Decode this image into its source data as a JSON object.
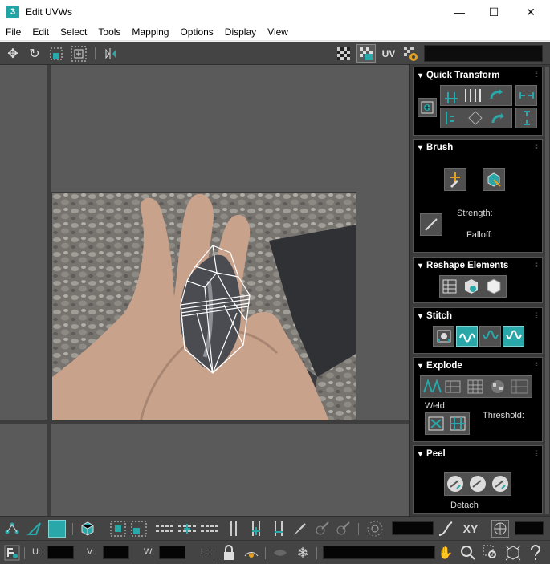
{
  "window": {
    "title": "Edit UVWs",
    "app_icon_text": "3",
    "minimize": "—",
    "maximize": "☐",
    "close": "✕"
  },
  "menu": [
    "File",
    "Edit",
    "Select",
    "Tools",
    "Mapping",
    "Options",
    "Display",
    "View"
  ],
  "toolbar": {
    "uv_label": "UV"
  },
  "panels": {
    "quick_transform": "Quick Transform",
    "brush": "Brush",
    "brush_strength": "Strength:",
    "brush_falloff": "Falloff:",
    "reshape": "Reshape Elements",
    "stitch": "Stitch",
    "explode": "Explode",
    "weld": "Weld",
    "threshold": "Threshold:",
    "peel": "Peel",
    "detach": "Detach"
  },
  "bottom": {
    "xy_label": "XY",
    "u_label": "U:",
    "v_label": "V:",
    "w_label": "W:",
    "l_label": "L:"
  },
  "colors": {
    "accent": "#2aa7a8",
    "panel_bg": "#000000",
    "toolbar_bg": "#444444",
    "viewport_bg": "#5a5a5a"
  }
}
